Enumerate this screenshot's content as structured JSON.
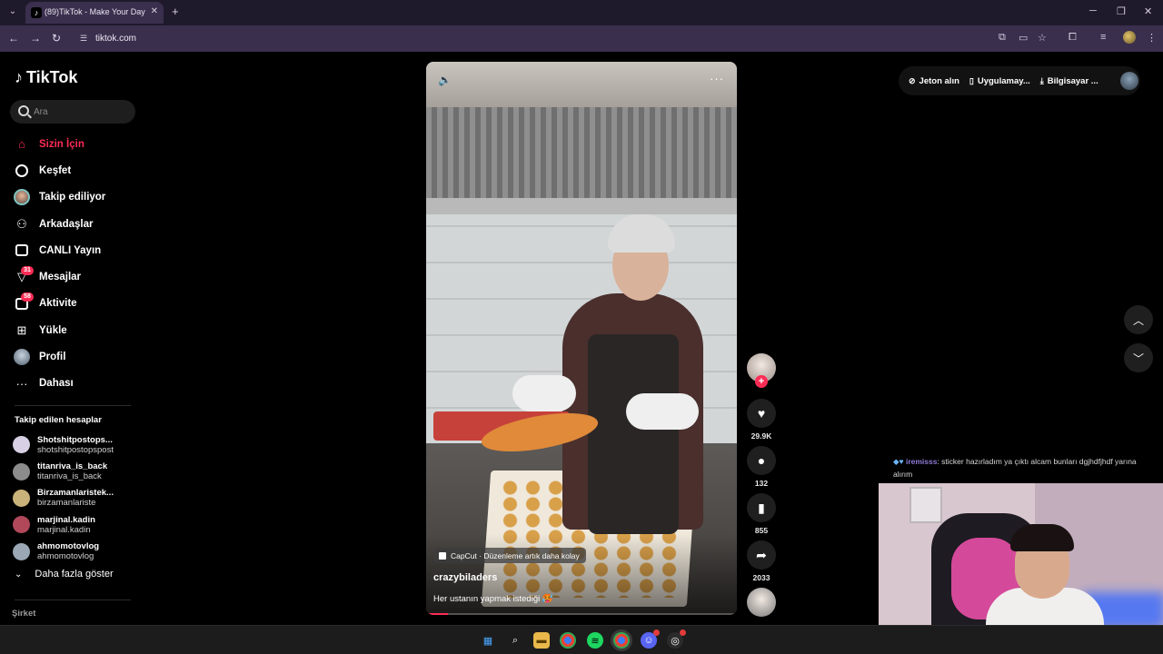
{
  "browser": {
    "tab_title": "(89)TikTok - Make Your Day",
    "url": "tiktok.com"
  },
  "tiktok": {
    "logo": "TikTok",
    "search_placeholder": "Ara",
    "nav": [
      {
        "label": "Sizin İçin",
        "icon": "home-icon",
        "active": true
      },
      {
        "label": "Keşfet",
        "icon": "compass-icon"
      },
      {
        "label": "Takip ediliyor",
        "icon": "following-avatar-icon"
      },
      {
        "label": "Arkadaşlar",
        "icon": "friends-icon"
      },
      {
        "label": "CANLI Yayın",
        "icon": "live-icon"
      },
      {
        "label": "Mesajlar",
        "icon": "messages-icon",
        "badge": "31"
      },
      {
        "label": "Aktivite",
        "icon": "activity-icon",
        "badge": "58"
      },
      {
        "label": "Yükle",
        "icon": "upload-icon"
      },
      {
        "label": "Profil",
        "icon": "profile-avatar-icon"
      },
      {
        "label": "Dahası",
        "icon": "more-icon"
      }
    ],
    "following_title": "Takip edilen hesaplar",
    "following": [
      {
        "name": "Shotshitpostops...",
        "handle": "shotshitpostopspost",
        "color": "#d8d0e4"
      },
      {
        "name": "titanriva_is_back",
        "handle": "titanriva_is_back",
        "color": "#8c8c8c"
      },
      {
        "name": "Birzamanlaristek...",
        "handle": "birzamanlariste",
        "color": "#c9b37a"
      },
      {
        "name": "marjinal.kadin",
        "handle": "marjinal.kadin",
        "color": "#b0485a"
      },
      {
        "name": "ahmomotovlog",
        "handle": "ahmomotovlog",
        "color": "#9aa7b4"
      }
    ],
    "show_more": "Daha fazla göster",
    "company": "Şirket",
    "header": {
      "coins": "Jeton alın",
      "app": "Uygulamay...",
      "desktop": "Bilgisayar ..."
    },
    "video": {
      "capcut": "CapCut · Düzenleme artık daha kolay",
      "author": "crazybiladers",
      "caption": "Her ustanın yapmak istediği 🥵",
      "progress": 0.07,
      "likes": "29.9K",
      "comments": "132",
      "saves": "855",
      "shares": "2033"
    }
  },
  "stream": {
    "chat_user": "iremisss",
    "chat_message": ": sticker hazırladım ya çıktı alcam bunları dgjhdfjhdf yarına alırım"
  },
  "colors": {
    "accent": "#fe2c55",
    "chrome": "#3a2f4d"
  }
}
